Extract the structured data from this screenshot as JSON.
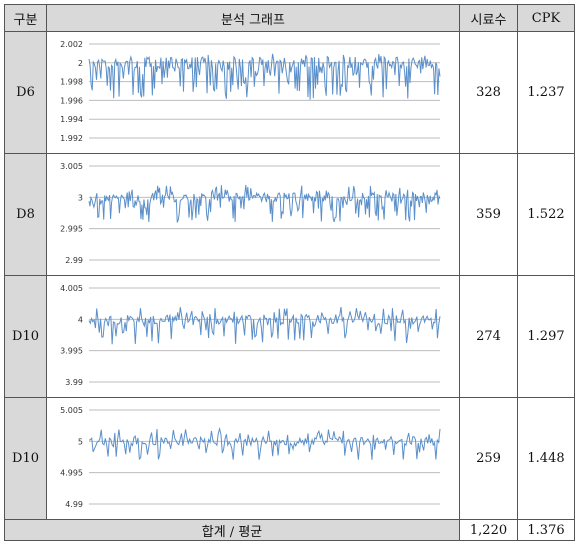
{
  "header": {
    "col_category": "구분",
    "col_chart": "분석 그래프",
    "col_samples": "시료수",
    "col_cpk": "CPK"
  },
  "rows": [
    {
      "label": "D6",
      "samples": "328",
      "cpk": "1.237"
    },
    {
      "label": "D8",
      "samples": "359",
      "cpk": "1.522"
    },
    {
      "label": "D10",
      "samples": "274",
      "cpk": "1.297"
    },
    {
      "label": "D10",
      "samples": "259",
      "cpk": "1.448"
    }
  ],
  "footer": {
    "label": "합계 / 평균",
    "samples_total": "1,220",
    "cpk_avg": "1.376"
  },
  "colors": {
    "series": "#5b8fc9",
    "header_bg": "#d9d9d9",
    "grid": "#bdbdbd"
  },
  "chart_data": [
    {
      "type": "line",
      "ylim": [
        1.992,
        2.002
      ],
      "yticks": [
        "2.002",
        "2",
        "1.998",
        "1.996",
        "1.994",
        "1.992"
      ],
      "series": [
        {
          "nominal": 2.0,
          "range": [
            1.996,
            2.001
          ],
          "points": 328
        }
      ]
    },
    {
      "type": "line",
      "ylim": [
        2.99,
        3.005
      ],
      "yticks": [
        "3.005",
        "3",
        "2.995",
        "2.99"
      ],
      "series": [
        {
          "nominal": 3.0,
          "range": [
            2.996,
            3.002
          ],
          "points": 359
        }
      ]
    },
    {
      "type": "line",
      "ylim": [
        3.99,
        4.005
      ],
      "yticks": [
        "4.005",
        "4",
        "3.995",
        "3.99"
      ],
      "series": [
        {
          "nominal": 4.0,
          "range": [
            3.996,
            4.002
          ],
          "points": 274
        }
      ]
    },
    {
      "type": "line",
      "ylim": [
        4.99,
        5.005
      ],
      "yticks": [
        "5.005",
        "5",
        "4.995",
        "4.99"
      ],
      "series": [
        {
          "nominal": 5.0,
          "range": [
            4.997,
            5.002
          ],
          "points": 259
        }
      ]
    }
  ]
}
